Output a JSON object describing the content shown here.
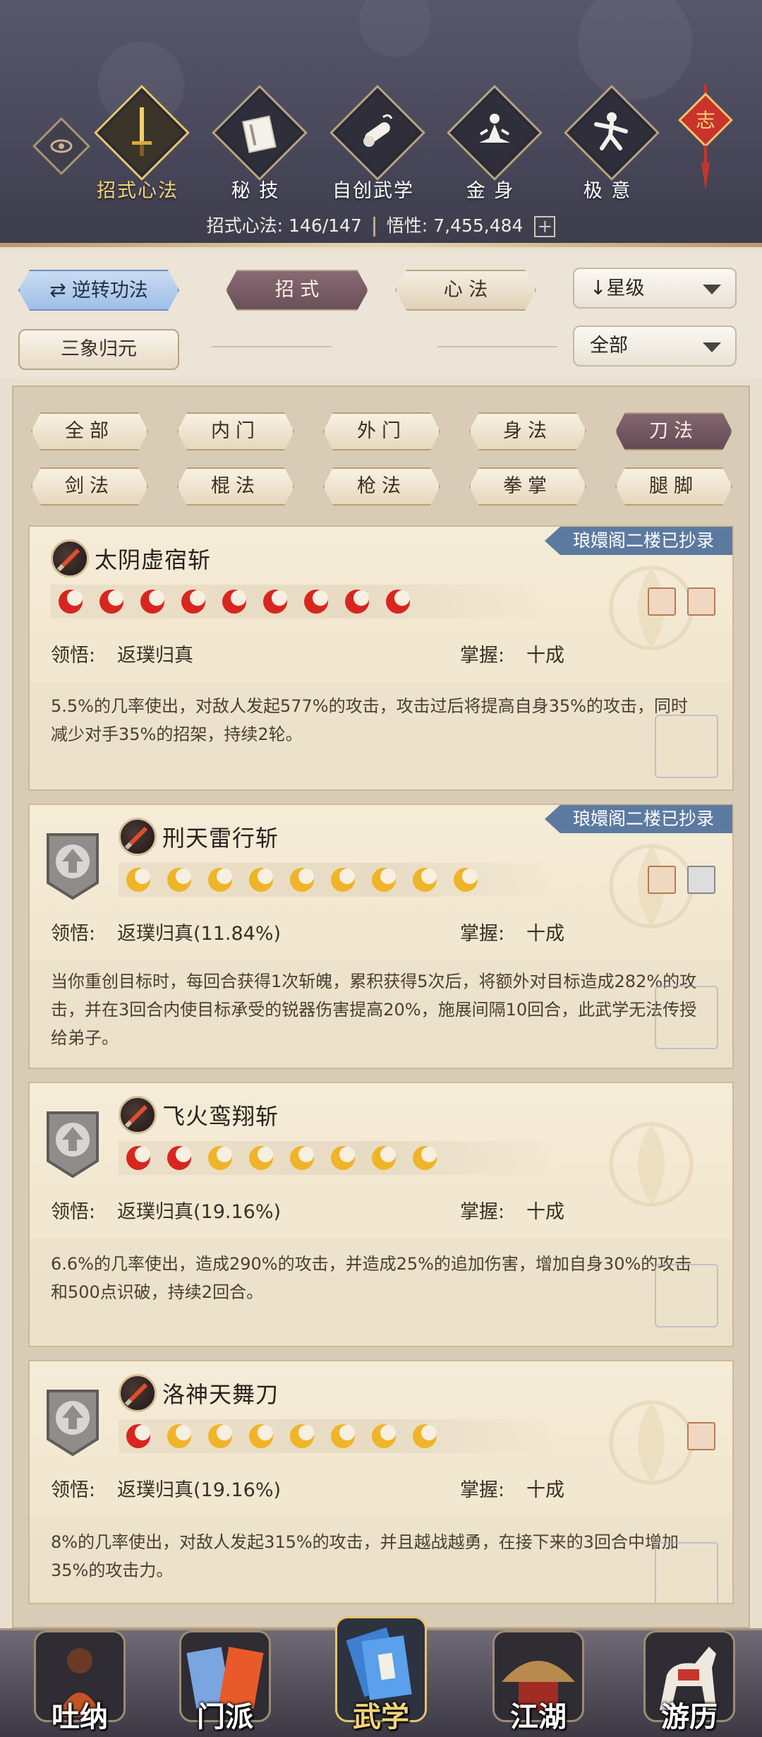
{
  "header": {
    "tabs": [
      {
        "label": "招式心法",
        "icon": "sword-icon",
        "active": true
      },
      {
        "label": "秘 技",
        "icon": "book-icon",
        "active": false
      },
      {
        "label": "自创武学",
        "icon": "scroll-icon",
        "active": false
      },
      {
        "label": "金 身",
        "icon": "meditate-icon",
        "active": false
      },
      {
        "label": "极 意",
        "icon": "martial-pose-icon",
        "active": false
      }
    ],
    "talisman_text": "志",
    "stats": {
      "skills_label": "招式心法:",
      "skills_value": "146/147",
      "insight_label": "悟性:",
      "insight_value": "7,455,484",
      "plus": "+"
    }
  },
  "controls": {
    "reverse_label": "逆转功法",
    "tab_moves": "招 式",
    "tab_mental": "心 法",
    "sort_label": "星级",
    "sancang_label": "三象归元",
    "filter_label": "全部"
  },
  "filters": [
    "全部",
    "内门",
    "外门",
    "身法",
    "刀法",
    "剑法",
    "棍法",
    "枪法",
    "拳掌",
    "腿脚"
  ],
  "selected_filter": "刀法",
  "skills": [
    {
      "name": "太阴虚宿斩",
      "copied": "琅嬛阁二楼已抄录",
      "stars_red": 9,
      "stars_gold": 0,
      "insight_label": "领悟:",
      "insight_value": "返璞归真",
      "mastery_label": "掌握:",
      "mastery_value": "十成",
      "desc": "5.5%的几率使出，对敌人发起577%的攻击，攻击过后将提高自身35%的攻击，同时减少对手35%的招架，持续2轮。"
    },
    {
      "name": "刑天雷行斩",
      "copied": "琅嬛阁二楼已抄录",
      "stars_red": 0,
      "stars_gold": 9,
      "insight_label": "领悟:",
      "insight_value": "返璞归真(11.84%)",
      "mastery_label": "掌握:",
      "mastery_value": "十成",
      "desc": "当你重创目标时，每回合获得1次斩魄，累积获得5次后，将额外对目标造成282%的攻击，并在3回合内使目标承受的锐器伤害提高20%，施展间隔10回合，此武学无法传授给弟子。"
    },
    {
      "name": "飞火鸾翔斩",
      "copied": "",
      "stars_red": 2,
      "stars_gold": 6,
      "insight_label": "领悟:",
      "insight_value": "返璞归真(19.16%)",
      "mastery_label": "掌握:",
      "mastery_value": "十成",
      "desc": "6.6%的几率使出，造成290%的攻击，并造成25%的追加伤害，增加自身30%的攻击和500点识破，持续2回合。"
    },
    {
      "name": "洛神天舞刀",
      "copied": "",
      "stars_red": 1,
      "stars_gold": 7,
      "insight_label": "领悟:",
      "insight_value": "返璞归真(19.16%)",
      "mastery_label": "掌握:",
      "mastery_value": "十成",
      "desc": "8%的几率使出，对敌人发起315%的攻击，并且越战越勇，在接下来的3回合中增加35%的攻击力。"
    }
  ],
  "bottom_nav": [
    {
      "label": "吐纳",
      "icon": "monk-icon",
      "active": false
    },
    {
      "label": "门派",
      "icon": "sect-banner-icon",
      "active": false
    },
    {
      "label": "武学",
      "icon": "martial-book-icon",
      "active": true
    },
    {
      "label": "江湖",
      "icon": "straw-hat-icon",
      "active": false
    },
    {
      "label": "游历",
      "icon": "horse-icon",
      "active": false
    }
  ],
  "colors": {
    "star_red": "#d8261f",
    "star_gold": "#f0b428",
    "selected_chip": "#6f5560",
    "active_tab_text": "#f2d374",
    "banner_blue": "#5c7aa0"
  }
}
